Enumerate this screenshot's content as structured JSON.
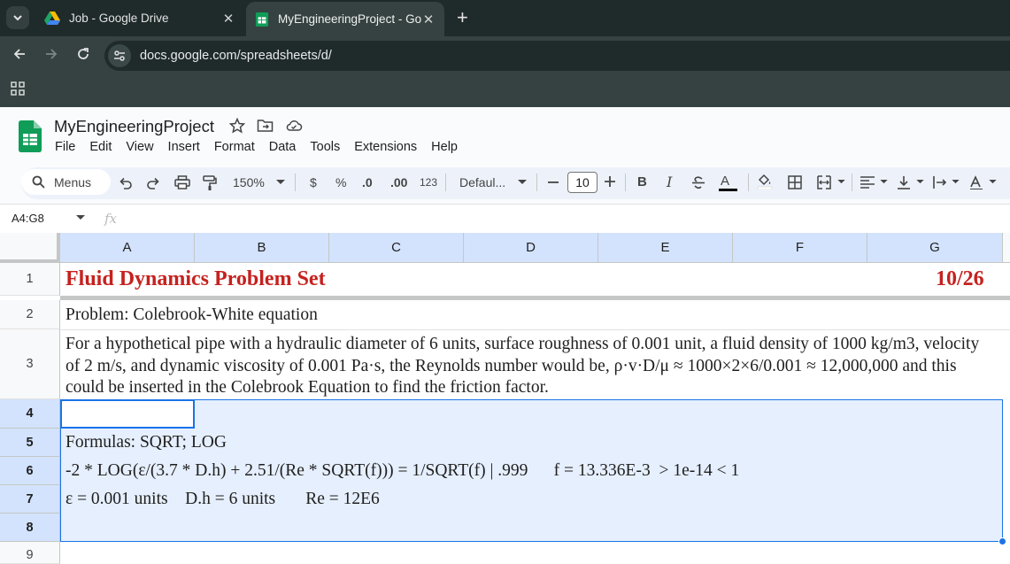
{
  "browser": {
    "tabs": [
      {
        "title": "Job - Google Drive",
        "active": false,
        "icon": "google-drive-icon"
      },
      {
        "title": "MyEngineeringProject - Google Sheets",
        "active": true,
        "icon": "google-sheets-icon"
      }
    ],
    "url": "docs.google.com/spreadsheets/d/",
    "theme_color": "#354241"
  },
  "sheets": {
    "doc_title": "MyEngineeringProject",
    "menu": [
      "File",
      "Edit",
      "View",
      "Insert",
      "Format",
      "Data",
      "Tools",
      "Extensions",
      "Help"
    ],
    "toolbar": {
      "menus_label": "Menus",
      "zoom": "150%",
      "currency": "$",
      "percent": "%",
      "decrease_decimal": ".0",
      "increase_decimal": ".00",
      "number_format": "123",
      "font": "Defaul...",
      "font_size": "10",
      "bold": "B",
      "italic": "I",
      "text_color": "A"
    },
    "name_box": "A4:G8",
    "fx": "fx"
  },
  "grid": {
    "columns": [
      "A",
      "B",
      "C",
      "D",
      "E",
      "F",
      "G"
    ],
    "rows": [
      "1",
      "2",
      "3",
      "4",
      "5",
      "6",
      "7",
      "8",
      "9"
    ],
    "selected_rows": [
      "4",
      "5",
      "6",
      "7",
      "8"
    ],
    "title_color": "#c5221f",
    "cells": {
      "A1": "Fluid Dynamics Problem Set",
      "G1": "10/26",
      "A2": "Problem: Colebrook-White equation",
      "A3": "For a hypothetical pipe with a hydraulic diameter of 6 units, surface roughness of 0.001 unit, a fluid density of 1000 kg/m3, velocity of 2 m/s, and dynamic viscosity of 0.001 Pa·s, the Reynolds number would be, ρ·v·D/μ ≈ 1000×2×6/0.001 ≈ 12,000,000 and this could be inserted in the Colebrook Equation to find the friction factor.",
      "A5": "Formulas: SQRT; LOG",
      "A6": "-2 * LOG(ε/(3.7 * D.h) + 2.51/(Re * SQRT(f))) = 1/SQRT(f) | .999      f = 13.336E-3  > 1e-14 < 1",
      "A7": "ε = 0.001 units    D.h = 6 units       Re = 12E6"
    }
  }
}
